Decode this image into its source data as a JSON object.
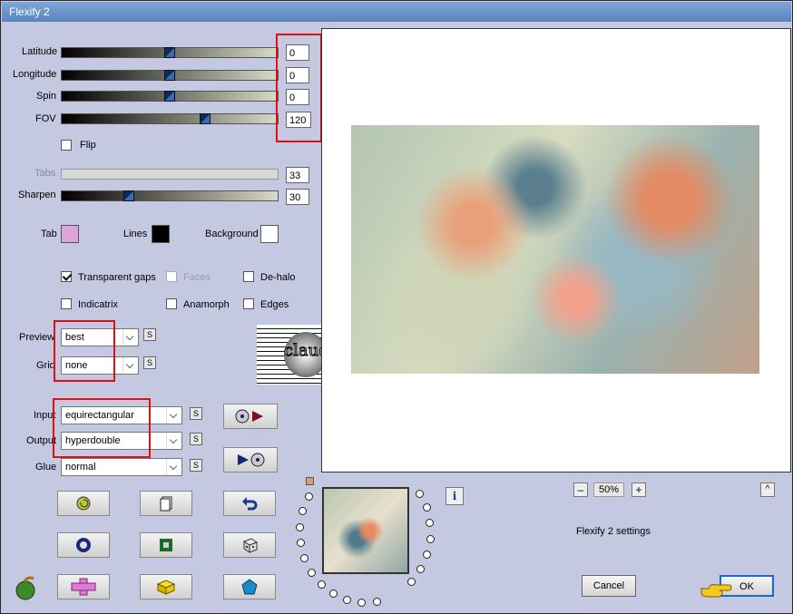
{
  "window": {
    "title": "Flexify 2"
  },
  "sliders": [
    {
      "label": "Latitude",
      "value": "0",
      "fraction": 0.5
    },
    {
      "label": "Longitude",
      "value": "0",
      "fraction": 0.5
    },
    {
      "label": "Spin",
      "value": "0",
      "fraction": 0.5
    },
    {
      "label": "FOV",
      "value": "120",
      "fraction": 0.67
    },
    {
      "label": "Tabs",
      "value": "33",
      "fraction": 0.0,
      "disabled": true
    },
    {
      "label": "Sharpen",
      "value": "30",
      "fraction": 0.3
    }
  ],
  "flip": {
    "label": "Flip",
    "checked": false
  },
  "colors": {
    "tab_label": "Tab",
    "tab_color": "#d9a5db",
    "lines_label": "Lines",
    "lines_color": "#000000",
    "background_label": "Background",
    "background_color": "#ffffff"
  },
  "options": {
    "transparent_gaps": "Transparent gaps",
    "faces": "Faces",
    "de_halo": "De-halo",
    "indicatrix": "Indicatrix",
    "anamorph": "Anamorph",
    "edges": "Edges"
  },
  "selects": {
    "preview_label": "Preview",
    "preview_value": "best",
    "grid_label": "Grid",
    "grid_value": "none",
    "input_label": "Input",
    "input_value": "equirectangular",
    "output_label": "Output",
    "output_value": "hyperdouble",
    "glue_label": "Glue",
    "glue_value": "normal",
    "s_label": "S"
  },
  "zoom": {
    "value": "50%",
    "minus": "–",
    "plus": "+"
  },
  "info_icon": "i",
  "caret": "^",
  "settings_label": "Flexify 2 settings",
  "buttons": {
    "cancel": "Cancel",
    "ok": "OK"
  },
  "watermark_text": "claudia"
}
